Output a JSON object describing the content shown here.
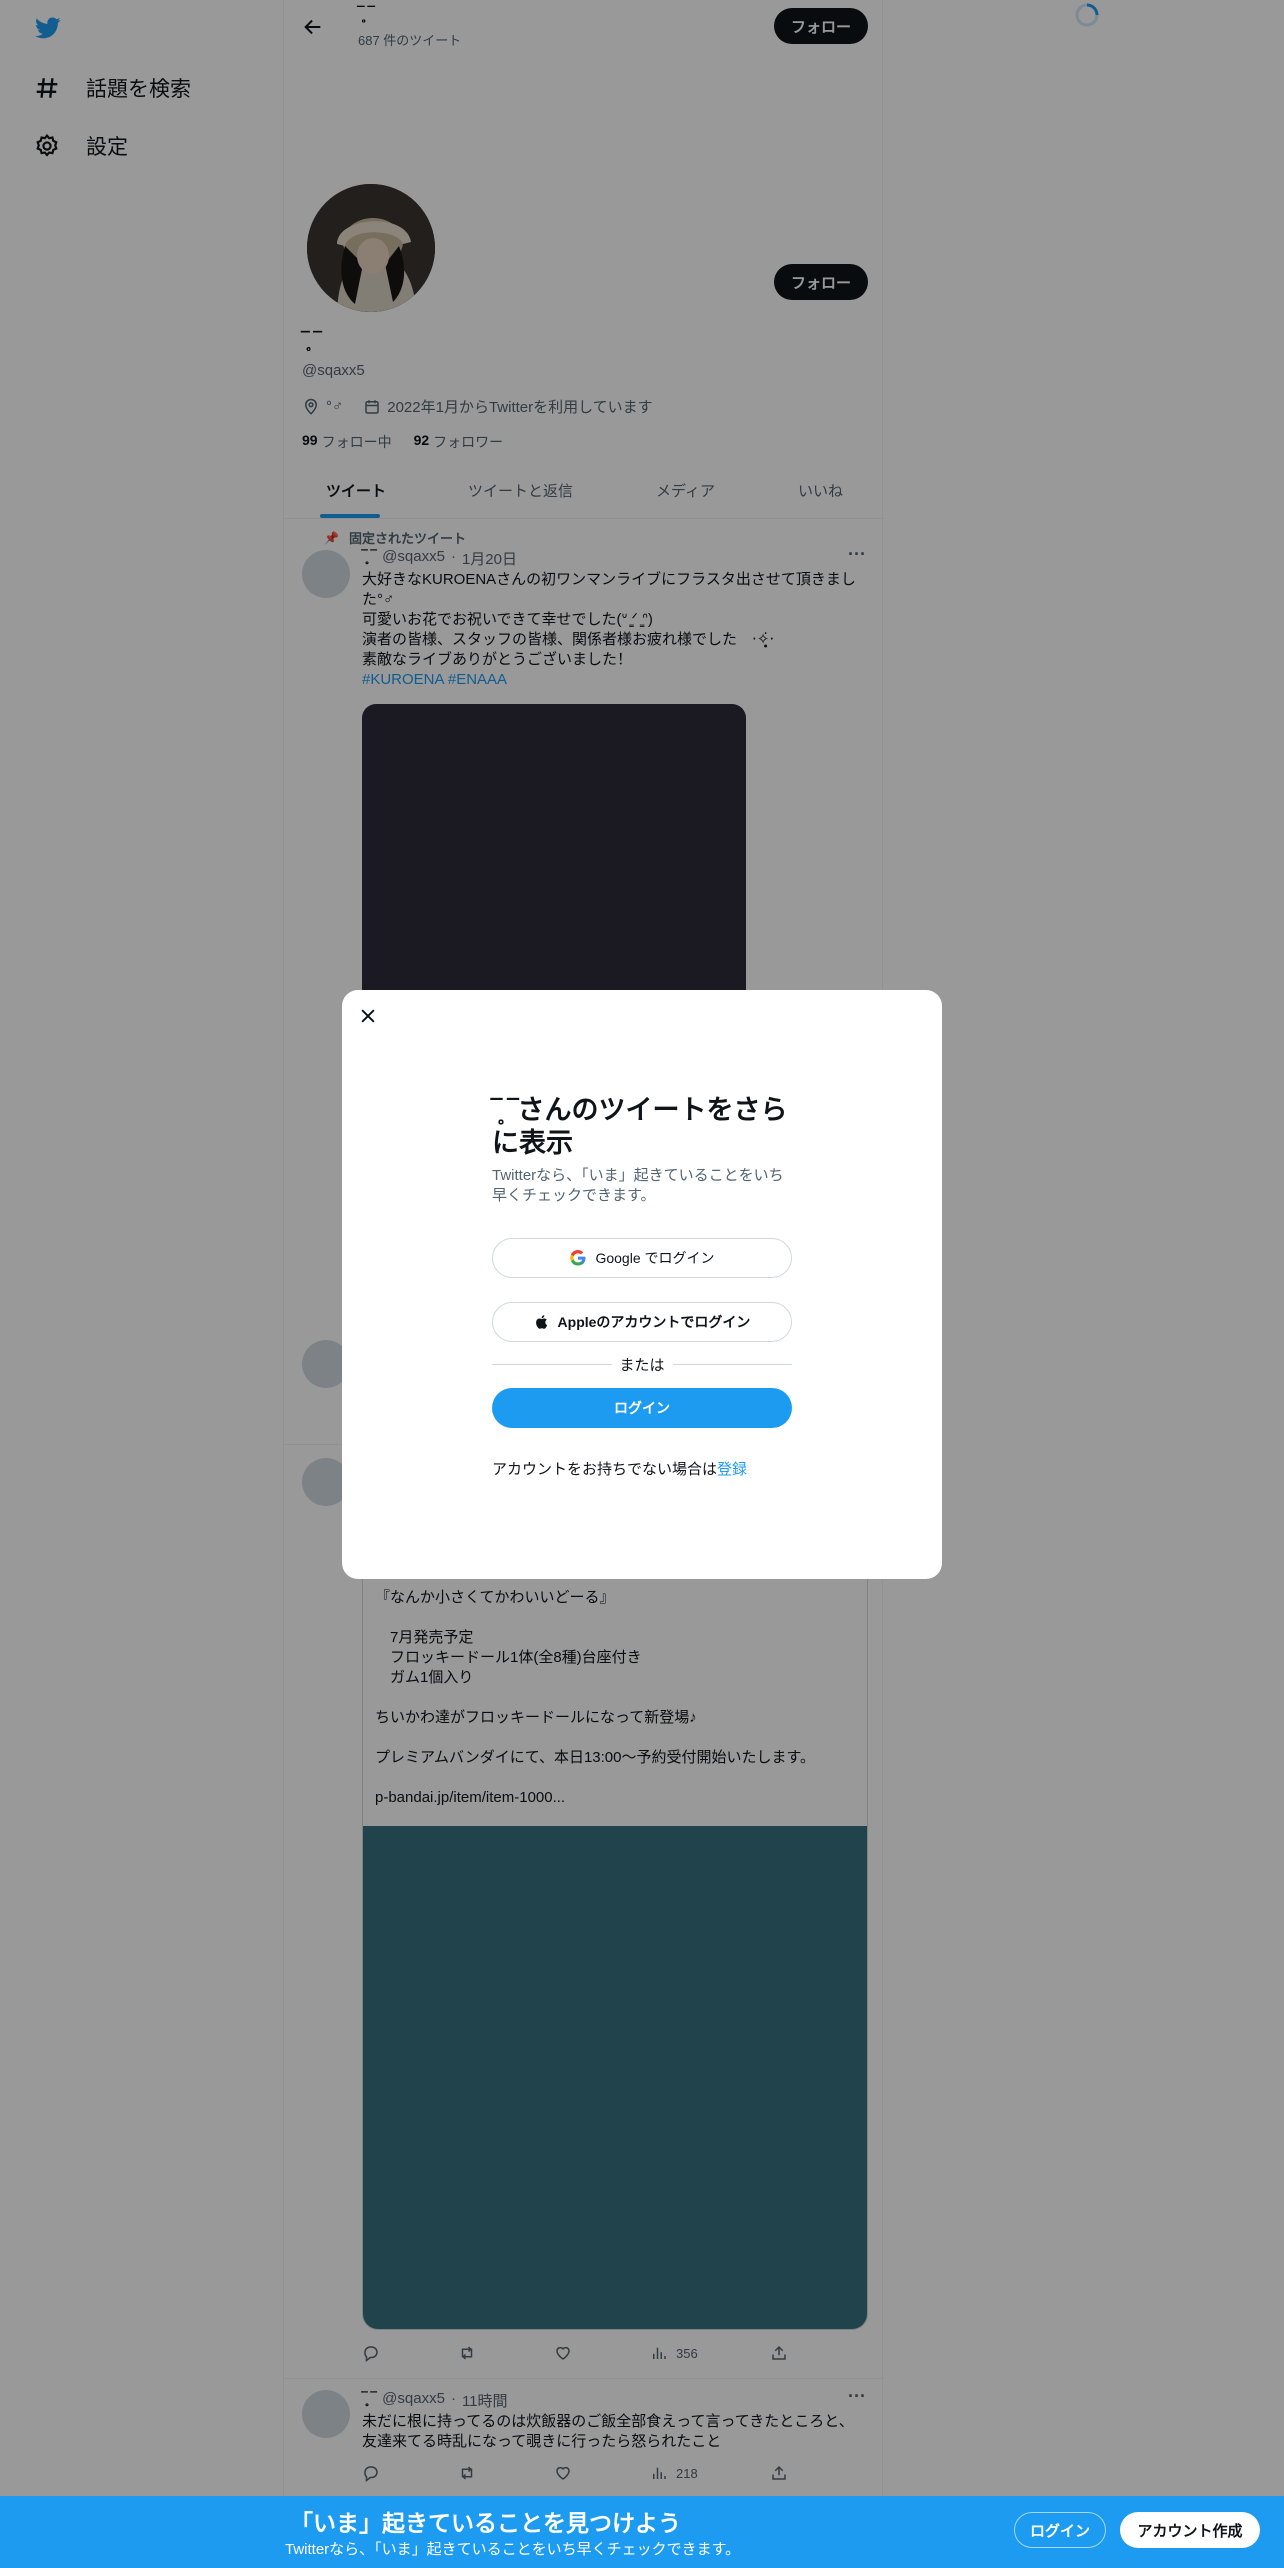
{
  "nav": {
    "explore_label": "話題を検索",
    "settings_label": "設定"
  },
  "header": {
    "name": "‾̥̥̥̥̥̥̥ ‾",
    "tweet_count": "687 件のツイート",
    "follow_label": "フォロー"
  },
  "profile": {
    "display_name": "‾̥̥̥̥̥̥̥ ‾",
    "handle": "@sqaxx5",
    "location": "°♂",
    "joined": "2022年1月からTwitterを利用しています",
    "following_count": "99",
    "following_label": "フォロー中",
    "followers_count": "92",
    "followers_label": "フォロワー",
    "follow_label": "フォロー"
  },
  "tabs": [
    "ツイート",
    "ツイートと返信",
    "メディア",
    "いいね"
  ],
  "pinned": {
    "label": "固定されたツイート",
    "name": "‾̥̥̥̥̥̥̥ ‾",
    "handle": "@sqaxx5",
    "date": "1月20日",
    "lines": [
      "大好きなKUROENAさんの初ワンマンライブにフラスタ出させて頂きまし",
      "た°♂",
      "可愛いお花でお祝いできて幸せでした(ᐡ ̳ᐟ ̳ᐢ)",
      "演者の皆様、スタッフの皆様、関係者様お疲れ様でした　‧✧̣̥̇‧",
      "素敵なライブありがとうございました！"
    ],
    "hashtags": "#KUROENA #ENAAA"
  },
  "retweet": {
    "lines": [
      "『なんか小さくてかわいいどーる』",
      "",
      "　7月発売予定",
      "　フロッキードール1体(全8種)台座付き",
      "　ガム1個入り",
      "",
      "ちいかわ達がフロッキードールになって新登場♪",
      "",
      "プレミアムバンダイにて、本日13:00〜予約受付開始いたします。",
      "",
      "p-bandai.jp/item/item-1000..."
    ],
    "views": "356"
  },
  "last_tweet": {
    "name": "‾̥̥̥̥̥̥̥ ‾",
    "handle": "@sqaxx5",
    "time": "11時間",
    "lines": [
      "未だに根に持ってるのは炊飯器のご飯全部食えって言ってきたところと、",
      "友達来てる時乱になって覗きに行ったら怒られたこと"
    ],
    "views": "218"
  },
  "modal": {
    "title": "‾̥̥̥̥̥̥̥ ‾さんのツイートをさらに表示",
    "subtitle": "Twitterなら、「いま」起きていることをいち早くチェックできます。",
    "google_label": "Google でログイン",
    "apple_label": "Appleのアカウントでログイン",
    "or_label": "または",
    "login_label": "ログイン",
    "signup_prompt": "アカウントをお持ちでない場合は",
    "signup_link": "登録"
  },
  "bottom_bar": {
    "title": "「いま」起きていることを見つけよう",
    "subtitle": "Twitterなら、「いま」起きていることをいち早くチェックできます。",
    "login_label": "ログイン",
    "signup_label": "アカウント作成"
  },
  "colors": {
    "accent": "#1d9bf0",
    "dark": "#0f1419",
    "muted": "#536471"
  }
}
